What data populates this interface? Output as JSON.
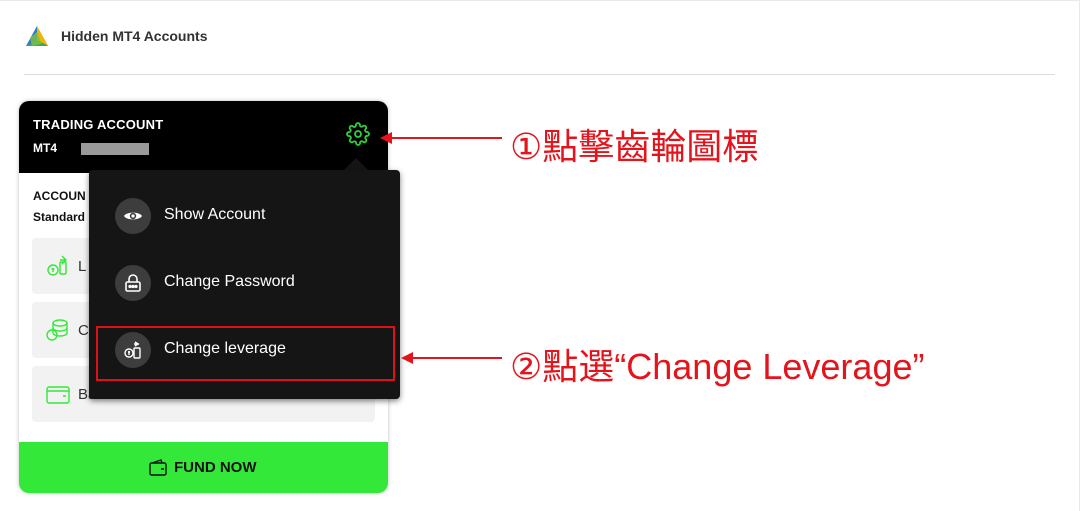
{
  "header": {
    "app_title": "Hidden MT4 Accounts",
    "logo_icon": "metatrader-logo-icon"
  },
  "card": {
    "title": "TRADING ACCOUNT",
    "platform": "MT4",
    "account_label": "ACCOUN",
    "account_type": "Standard",
    "stats": [
      {
        "icon": "leverage-icon",
        "label": "L"
      },
      {
        "icon": "coins-icon",
        "label": "C"
      },
      {
        "icon": "wallet-icon",
        "label": "Balance"
      }
    ],
    "fund_button": "FUND NOW",
    "gear_icon": "gear-icon"
  },
  "menu": {
    "items": [
      {
        "icon": "eye-icon",
        "label": "Show Account"
      },
      {
        "icon": "lock-icon",
        "label": "Change Password"
      },
      {
        "icon": "leverage-coins-icon",
        "label": "Change leverage"
      }
    ]
  },
  "annotations": {
    "step1": "①點擊齒輪圖標",
    "step2": "②點選“Change Leverage”"
  },
  "colors": {
    "accent_green": "#34e83a",
    "gear_green": "#2fd13a",
    "annotation_red": "#e3141c",
    "header_black": "#000000",
    "menu_bg": "#151515"
  }
}
